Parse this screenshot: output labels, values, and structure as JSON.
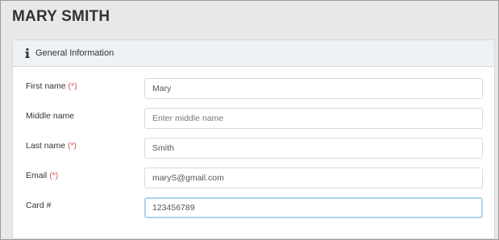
{
  "page": {
    "title": "MARY SMITH"
  },
  "panel": {
    "header_icon": "info-icon",
    "header_title": "General Information"
  },
  "form": {
    "required_marker": "(*)",
    "first_name": {
      "label": "First name",
      "required": true,
      "value": "Mary",
      "placeholder": ""
    },
    "middle_name": {
      "label": "Middle name",
      "required": false,
      "value": "",
      "placeholder": "Enter middle name"
    },
    "last_name": {
      "label": "Last name",
      "required": true,
      "value": "Smith",
      "placeholder": ""
    },
    "email": {
      "label": "Email",
      "required": true,
      "value": "maryS@gmail.com",
      "placeholder": ""
    },
    "card": {
      "label": "Card #",
      "required": false,
      "value": "123456789",
      "placeholder": ""
    }
  },
  "colors": {
    "required": "#d9534f",
    "focus_border": "#a9d3ec",
    "panel_header_bg": "#eef2f5"
  }
}
